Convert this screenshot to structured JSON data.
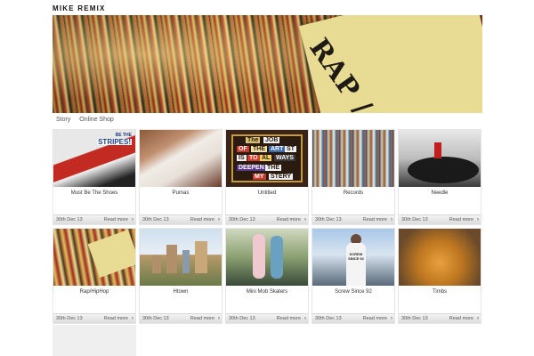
{
  "site": {
    "title": "MIKE REMIX"
  },
  "banner": {
    "sign_text": "RAP / HIP-HOP"
  },
  "nav": {
    "items": [
      "Story",
      "Online Shop"
    ]
  },
  "posts": [
    {
      "title": "Must Be The Shoes",
      "date": "30th Dec 13",
      "more": "Read more",
      "thumb_text": [
        "BE THE",
        "STRIPES!"
      ]
    },
    {
      "title": "Pumas",
      "date": "30th Dec 13",
      "more": "Read more"
    },
    {
      "title": "Untitled",
      "date": "30th Dec 13",
      "more": "Read more",
      "thumb_text": [
        "The",
        "JOB",
        "OF",
        "THE",
        "ART",
        "ST",
        "IS",
        "TO",
        "AL",
        "WAYS",
        "DEEPEN",
        "THE",
        "MY",
        "STERY"
      ]
    },
    {
      "title": "Records",
      "date": "30th Dec 13",
      "more": "Read more"
    },
    {
      "title": "Needle",
      "date": "30th Dec 13",
      "more": "Read more"
    },
    {
      "title": "Rap/HipHop",
      "date": "30th Dec 13",
      "more": "Read more"
    },
    {
      "title": "Htown",
      "date": "30th Dec 13",
      "more": "Read more"
    },
    {
      "title": "Mini Mob Skaters",
      "date": "30th Dec 13",
      "more": "Read more"
    },
    {
      "title": "Screw Since 92",
      "date": "30th Dec 13",
      "more": "Read more",
      "thumb_text": [
        "SCREW",
        "SINCE 92"
      ]
    },
    {
      "title": "Timbs",
      "date": "30th Dec 13",
      "more": "Read more"
    }
  ],
  "icons": {
    "read_more": "chevron-right-icon"
  },
  "colors": {
    "footer_bar": "#dcdcdc",
    "title_text": "#111111"
  }
}
